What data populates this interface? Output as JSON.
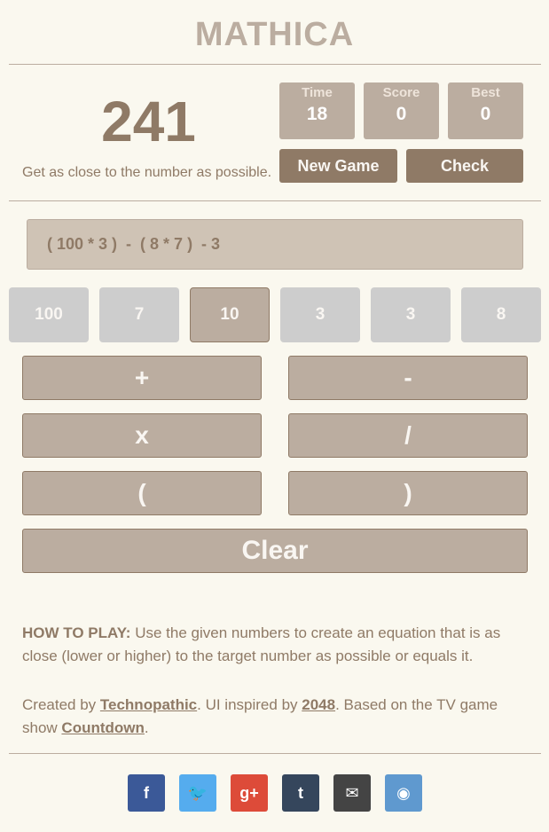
{
  "app": {
    "title": "MATHICA"
  },
  "target": {
    "value": "241",
    "hint": "Get as close to the number as possible."
  },
  "stats": [
    {
      "label": "Time",
      "value": "18"
    },
    {
      "label": "Score",
      "value": "0"
    },
    {
      "label": "Best",
      "value": "0"
    }
  ],
  "buttons": {
    "new_game": "New Game",
    "check": "Check",
    "clear": "Clear"
  },
  "expression": "( 100 * 3 )  -  ( 8 * 7 )  - 3",
  "numbers": [
    {
      "value": "100",
      "selected": false
    },
    {
      "value": "7",
      "selected": false
    },
    {
      "value": "10",
      "selected": true
    },
    {
      "value": "3",
      "selected": false
    },
    {
      "value": "3",
      "selected": false
    },
    {
      "value": "8",
      "selected": false
    }
  ],
  "operators": {
    "plus": "+",
    "minus": "-",
    "times": "x",
    "divide": "/",
    "lparen": "(",
    "rparen": ")"
  },
  "how_to_play": {
    "heading": "HOW TO PLAY:",
    "text": " Use the given numbers to create an equation that is as close (lower or higher) to the target number as possible or equals it."
  },
  "credits": {
    "created_by": "Created by ",
    "author": "Technopathic",
    "ui_inspired": ". UI inspired by ",
    "inspiration": "2048",
    "based_on": ". Based on the TV game show ",
    "show": "Countdown",
    "end": "."
  },
  "social": [
    {
      "icon": "facebook-icon",
      "glyph": "f",
      "color": "#3b5998"
    },
    {
      "icon": "twitter-icon",
      "glyph": "🐦",
      "color": "#55acee"
    },
    {
      "icon": "google-plus-icon",
      "glyph": "g+",
      "color": "#dd4b39"
    },
    {
      "icon": "tumblr-icon",
      "glyph": "t",
      "color": "#35465c"
    },
    {
      "icon": "email-icon",
      "glyph": "✉",
      "color": "#444444"
    },
    {
      "icon": "reddit-icon",
      "glyph": "◉",
      "color": "#5f99cf"
    }
  ]
}
